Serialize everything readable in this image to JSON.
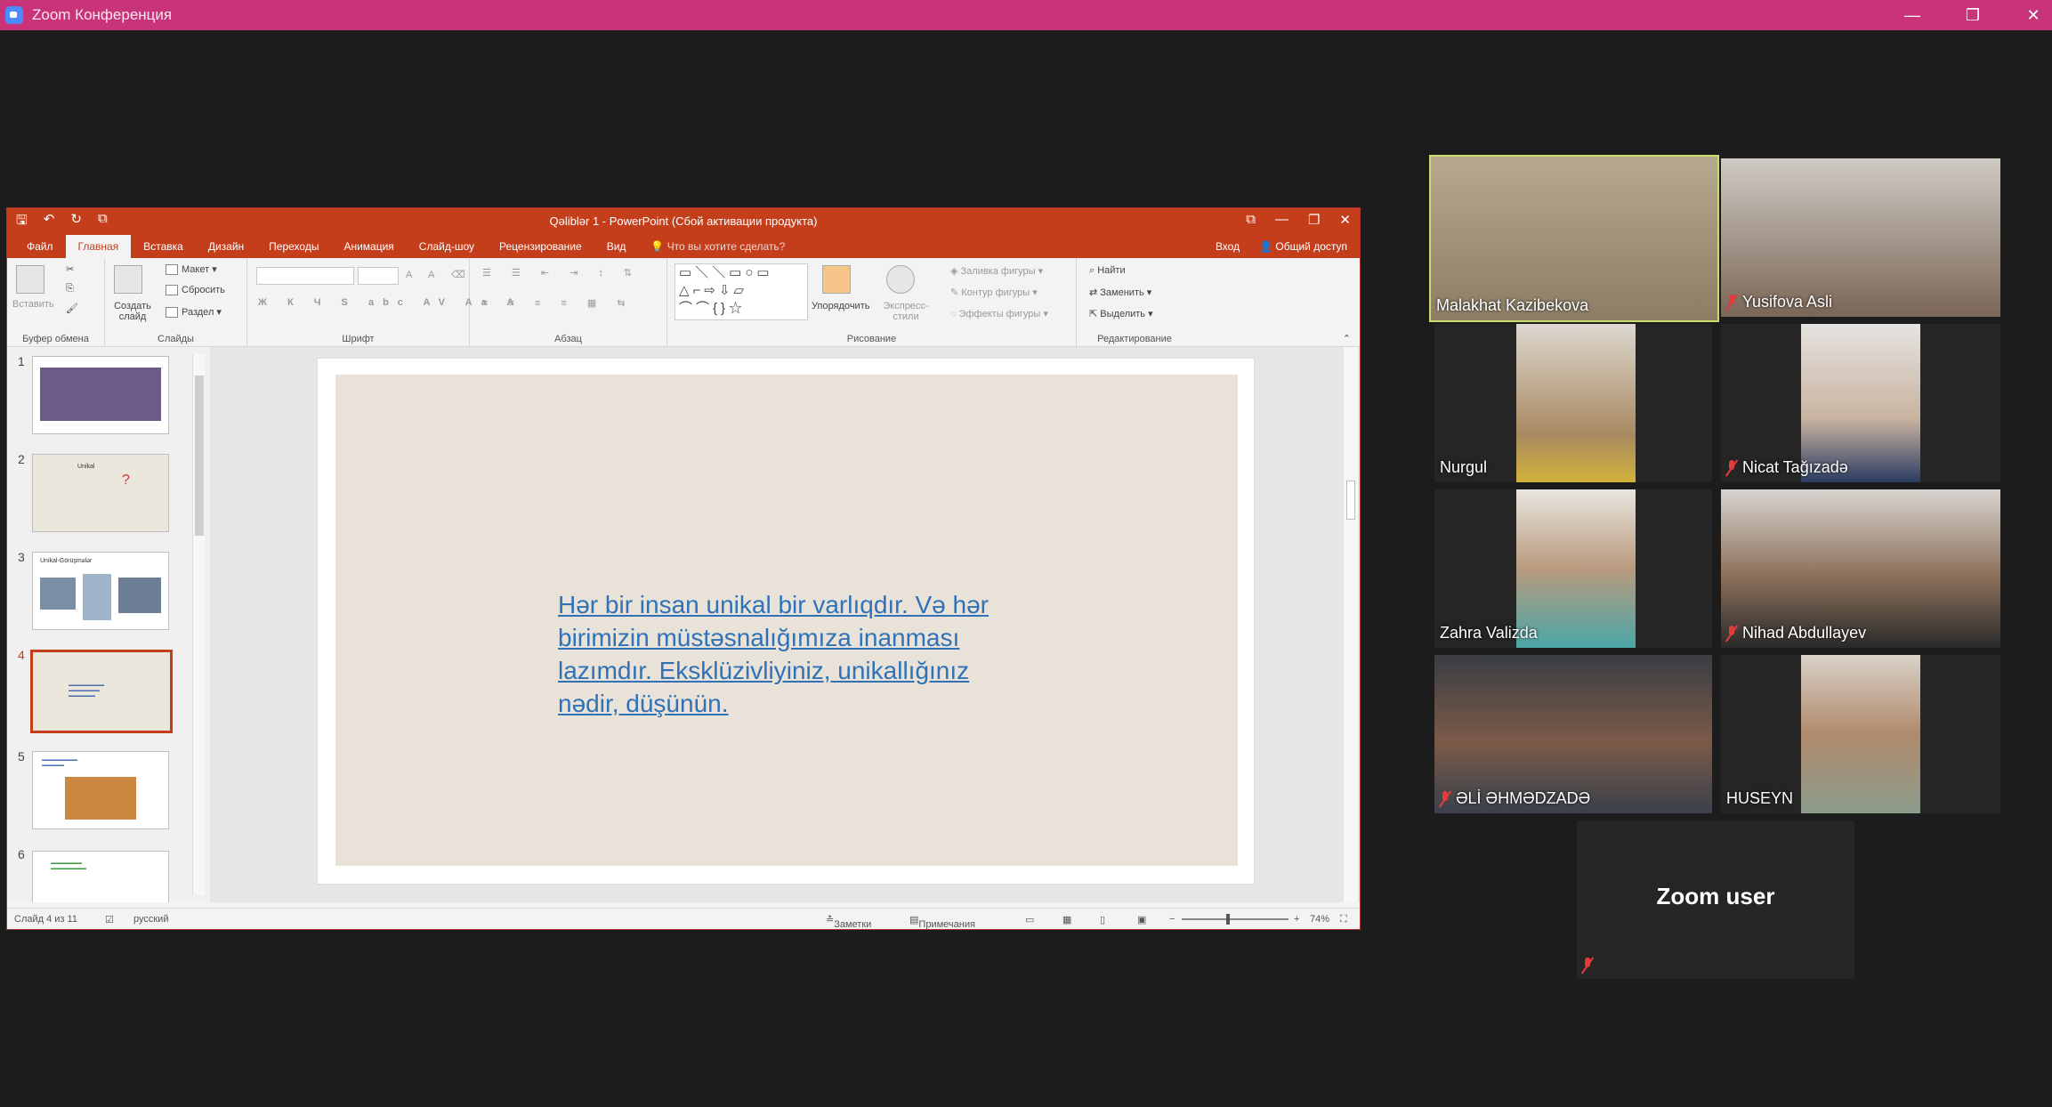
{
  "zoom": {
    "title": "Zoom Конференция",
    "window_controls": [
      "—",
      "❐",
      "✕"
    ]
  },
  "powerpoint": {
    "title": "Qəliblər 1 - PowerPoint (Сбой активации продукта)",
    "window_controls": [
      "⧉",
      "—",
      "❐",
      "✕"
    ],
    "tabs": [
      "Файл",
      "Главная",
      "Вставка",
      "Дизайн",
      "Переходы",
      "Анимация",
      "Слайд-шоу",
      "Рецензирование",
      "Вид"
    ],
    "active_tab": "Главная",
    "tell_me": "Что вы хотите сделать?",
    "signin": "Вход",
    "share": "Общий доступ",
    "ribbon": {
      "clipboard": {
        "paste": "Вставить",
        "label": "Буфер обмена"
      },
      "slides": {
        "new_slide": "Создать слайд",
        "layout": "Макет",
        "reset": "Сбросить",
        "section": "Раздел",
        "label": "Слайды"
      },
      "font": {
        "label": "Шрифт"
      },
      "paragraph": {
        "label": "Абзац"
      },
      "drawing": {
        "arrange": "Упорядочить",
        "quick_styles": "Экспресс-стили",
        "fill": "Заливка фигуры",
        "outline": "Контур фигуры",
        "effects": "Эффекты фигуры",
        "label": "Рисование"
      },
      "editing": {
        "find": "Найти",
        "replace": "Заменить",
        "select": "Выделить",
        "label": "Редактирование"
      }
    },
    "thumbnails": [
      {
        "num": "1",
        "label": ""
      },
      {
        "num": "2",
        "label": "Unikal"
      },
      {
        "num": "3",
        "label": "Unikal-Görüşmələr"
      },
      {
        "num": "4",
        "label": ""
      },
      {
        "num": "5",
        "label": ""
      },
      {
        "num": "6",
        "label": ""
      }
    ],
    "slide_text": "Hər bir insan unikal bir varlıqdır. Və hər birimizin müstəsnalığımıza inanması lazımdır. Eksklüzivliyiniz, unikallığınız nədir, düşünün.",
    "status": {
      "slide": "Слайд 4 из 11",
      "language": "русский",
      "notes": "Заметки",
      "comments": "Примечания",
      "zoom": "74%"
    }
  },
  "participants": [
    {
      "name": "Malakhat Kazibekova",
      "muted": false,
      "active_speaker": true
    },
    {
      "name": "Yusifova Asli",
      "muted": true,
      "active_speaker": false
    },
    {
      "name": "Nurgul",
      "muted": false,
      "active_speaker": false
    },
    {
      "name": "Nicat Tağızadə",
      "muted": true,
      "active_speaker": false
    },
    {
      "name": "Zahra Valizda",
      "muted": false,
      "active_speaker": false
    },
    {
      "name": "Nihad Abdullayev",
      "muted": true,
      "active_speaker": false
    },
    {
      "name": "ƏLİ ƏHMƏDZADƏ",
      "muted": true,
      "active_speaker": false
    },
    {
      "name": "HUSEYN",
      "muted": false,
      "active_speaker": false
    },
    {
      "name": "Zoom user",
      "muted": true,
      "active_speaker": false
    }
  ]
}
